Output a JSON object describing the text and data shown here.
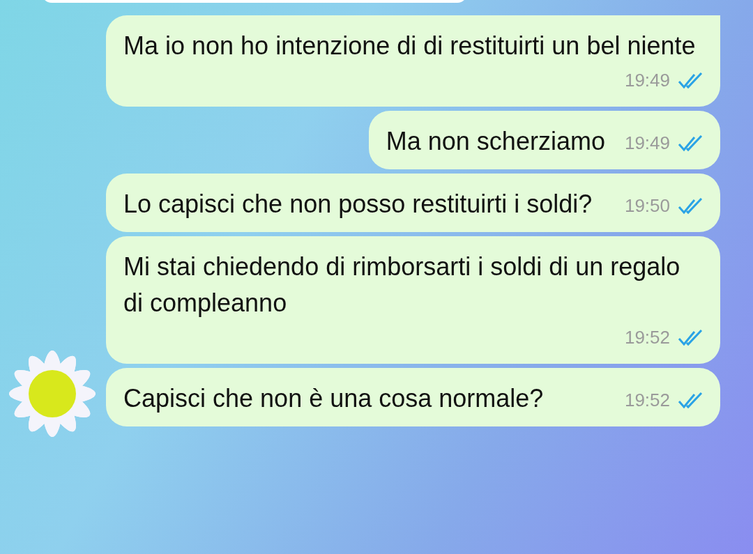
{
  "messages": [
    {
      "text": "Ma io non ho intenzione di di restituirti un bel niente",
      "time": "19:49",
      "read": true
    },
    {
      "text": "Ma non scherziamo",
      "time": "19:49",
      "read": true
    },
    {
      "text": "Lo capisci che non posso restituirti i soldi?",
      "time": "19:50",
      "read": true
    },
    {
      "text": "Mi stai chiedendo di rimborsarti i soldi di un regalo di compleanno",
      "time": "19:52",
      "read": true
    },
    {
      "text": "Capisci che non è una cosa normale?",
      "time": "19:52",
      "read": true
    }
  ]
}
